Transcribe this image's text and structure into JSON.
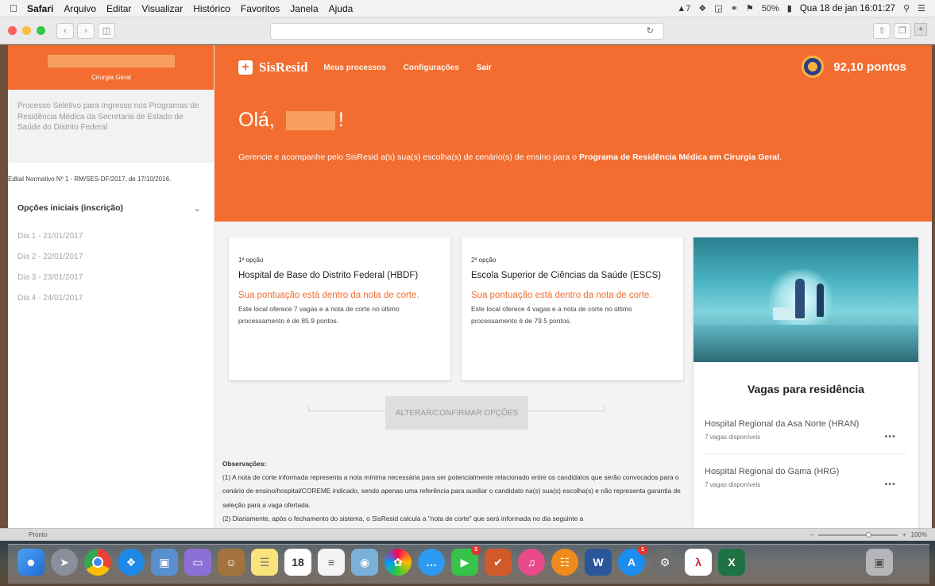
{
  "menubar": {
    "app": "Safari",
    "items": [
      "Arquivo",
      "Editar",
      "Visualizar",
      "Histórico",
      "Favoritos",
      "Janela",
      "Ajuda"
    ],
    "battery": "50%",
    "datetime": "Qua 18 de jan  16:01:27"
  },
  "sidebar": {
    "specialty": "Cirurgia Geral",
    "process_title": "Processo Seletivo para Ingresso nos Programas de Residência Médica da Secretaria de Estado de Saúde do Distrito Federal",
    "edital": "Edital Normativo Nº 1 - RM/SES-DF/2017, de 17/10/2016.",
    "options_label": "Opções iniciais (inscrição)",
    "days": [
      "Dia 1 - 21/01/2017",
      "Dia 2 - 22/01/2017",
      "Dia 3 - 23/01/2017",
      "Dia 4 - 24/01/2017"
    ]
  },
  "nav": {
    "logo": "SisResid",
    "links": [
      "Meus processos",
      "Configurações"
    ],
    "logout": "Sair",
    "points": "92,10 pontos"
  },
  "hero": {
    "greeting_prefix": "Olá,",
    "greeting_suffix": "!",
    "message": "Gerencie e acompanhe pelo SisResid a(s) sua(s) escolha(s) de cenário(s) de ensino para o ",
    "program": "Programa de Residência Médica em Cirurgia Geral",
    "period": "."
  },
  "options": [
    {
      "label": "1ª opção",
      "hospital": "Hospital de Base do Distrito Federal (HBDF)",
      "status": "Sua pontuação está dentro da nota de corte.",
      "info": "Este local oferece 7 vagas e a nota de corte no último processamento é de 85.9 pontos."
    },
    {
      "label": "2ª opção",
      "hospital": "Escola Superior de Ciências da Saúde (ESCS)",
      "status": "Sua pontuação está dentro da nota de corte.",
      "info": "Este local oferece 4 vagas e a nota de corte no último processamento é de 79.5 pontos."
    }
  ],
  "confirm_button": "ALTERAR/CONFIRMAR OPÇÕES",
  "observations": {
    "title": "Observações:",
    "text1": "(1) A nota de corte informada representa a nota mínima necessária para ser potencialmente relacionado entre os candidatos que serão convocados para o cenário de ensino/hospital/COREME indicado, sendo apenas uma referência para auxiliar o candidato na(s) sua(s) escolha(s) e não representa garantia de seleção para a vaga ofertada.",
    "text2": "(2) Diariamente, após o fechamento do sistema, o SisResid calcula a \"nota de corte\" que será informada no dia seguinte a"
  },
  "vagas": {
    "title": "Vagas para residência",
    "items": [
      {
        "name": "Hospital Regional da Asa Norte (HRAN)",
        "count": "7 vagas disponíveis"
      },
      {
        "name": "Hospital Regional do Gama (HRG)",
        "count": "7 vagas disponíveis"
      }
    ]
  },
  "statusbar": {
    "text": "Pronto",
    "zoom": "100%"
  },
  "dock": {
    "calendar_day": "18",
    "badges": {
      "facetime": "3",
      "appstore": "1"
    }
  },
  "colors": {
    "accent": "#f26d2f",
    "accent_light": "#f7a05d"
  }
}
